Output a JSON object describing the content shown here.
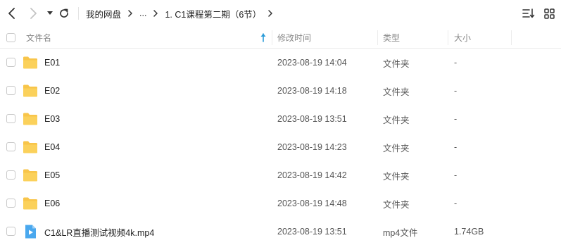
{
  "toolbar": {
    "breadcrumbs": [
      "我的网盘",
      "...",
      "1. C1课程第二期（6节）"
    ]
  },
  "header": {
    "name": "文件名",
    "modified": "修改时间",
    "type": "类型",
    "size": "大小"
  },
  "files": [
    {
      "name": "E01",
      "modified": "2023-08-19 14:04",
      "type": "文件夹",
      "size": "-",
      "icon": "folder-icon"
    },
    {
      "name": "E02",
      "modified": "2023-08-19 14:18",
      "type": "文件夹",
      "size": "-",
      "icon": "folder-icon"
    },
    {
      "name": "E03",
      "modified": "2023-08-19 13:51",
      "type": "文件夹",
      "size": "-",
      "icon": "folder-icon"
    },
    {
      "name": "E04",
      "modified": "2023-08-19 14:23",
      "type": "文件夹",
      "size": "-",
      "icon": "folder-icon"
    },
    {
      "name": "E05",
      "modified": "2023-08-19 14:42",
      "type": "文件夹",
      "size": "-",
      "icon": "folder-icon"
    },
    {
      "name": "E06",
      "modified": "2023-08-19 14:48",
      "type": "文件夹",
      "size": "-",
      "icon": "folder-icon"
    },
    {
      "name": "C1&LR直播测试视频4k.mp4",
      "modified": "2023-08-19 13:51",
      "type": "mp4文件",
      "size": "1.74GB",
      "icon": "video-file-icon"
    }
  ],
  "colors": {
    "folder": "#f8c54a",
    "video": "#4aa8ee",
    "sort_accent": "#2a9bd8"
  }
}
